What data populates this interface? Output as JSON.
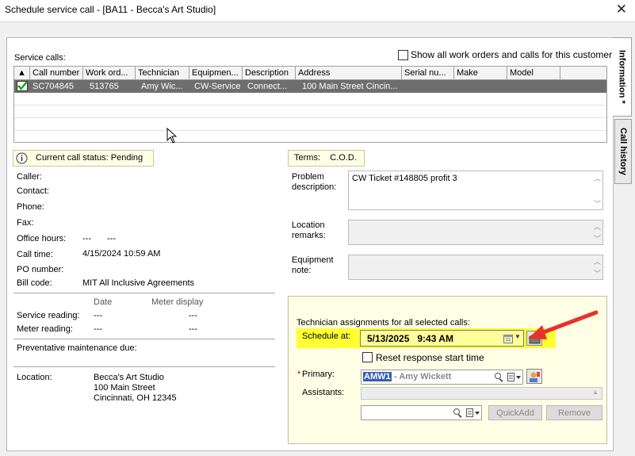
{
  "window": {
    "title": "Schedule service call - [BA11 - Becca's Art Studio]",
    "close_glyph": "✕"
  },
  "tabs": [
    {
      "label": "Information *",
      "active": true
    },
    {
      "label": "Call history",
      "active": false
    }
  ],
  "service_calls": {
    "label": "Service calls:",
    "show_all_label": "Show all work orders and calls for this customer",
    "sort_glyph": "▲",
    "columns": [
      "Call number",
      "Work ord...",
      "Technician",
      "Equipmen...",
      "Description",
      "Address",
      "Serial nu...",
      "Make",
      "Model"
    ],
    "rows": [
      {
        "selected": true,
        "call_number": "SC704845",
        "work_order": "513765",
        "technician": "Amy Wic...",
        "equipment": "CW-Service",
        "description": "Connect...",
        "address": "100 Main Street Cincin...",
        "serial": "",
        "make": "",
        "model": ""
      }
    ]
  },
  "status": {
    "icon": "info-icon",
    "text": "Current call status: Pending"
  },
  "terms": {
    "text": "Terms:    C.O.D."
  },
  "caller_info": {
    "caller_label": "Caller:",
    "contact_label": "Contact:",
    "phone_label": "Phone:",
    "fax_label": "Fax:",
    "office_hours_label": "Office hours:",
    "office_hours_from": "---",
    "office_hours_to": "---",
    "call_time_label": "Call time:",
    "call_time_value": "4/15/2024 10:59 AM",
    "po_label": "PO number:",
    "bill_code_label": "Bill code:",
    "bill_code_value": "MIT All Inclusive Agreements"
  },
  "meters": {
    "date_header": "Date",
    "meter_display_header": "Meter display",
    "service_reading_label": "Service reading:",
    "service_reading_date": "---",
    "service_reading_display": "---",
    "meter_reading_label": "Meter reading:",
    "meter_reading_date": "---",
    "meter_reading_display": "---"
  },
  "pm": {
    "label": "Preventative maintenance due:"
  },
  "location": {
    "label": "Location:",
    "line1": "Becca's Art Studio",
    "line2": "100 Main Street",
    "line3": "Cincinnati, OH 12345"
  },
  "problem": {
    "label_line1": "Problem",
    "label_line2": "description:",
    "value": "CW Ticket #148805 profit 3"
  },
  "location_remarks": {
    "label_line1": "Location",
    "label_line2": "remarks:"
  },
  "equipment_note": {
    "label_line1": "Equipment",
    "label_line2": "note:"
  },
  "assignments": {
    "header": "Technician assignments for all selected calls:",
    "schedule_label": "Schedule at:",
    "schedule_value": "5/13/2025   9:43 AM",
    "reset_label": "Reset response start time",
    "primary_required": "*",
    "primary_label": "Primary:",
    "primary_code": "AMW1",
    "primary_name": " - Amy Wickett",
    "assistants_label": "Assistants:",
    "quickadd_label": "QuickAdd",
    "remove_label": "Remove"
  },
  "colors": {
    "highlight": "#ffff33",
    "arrow": "#e8322a",
    "selected_row": "#6e6e6e",
    "panel_bg": "#ffffe6"
  }
}
